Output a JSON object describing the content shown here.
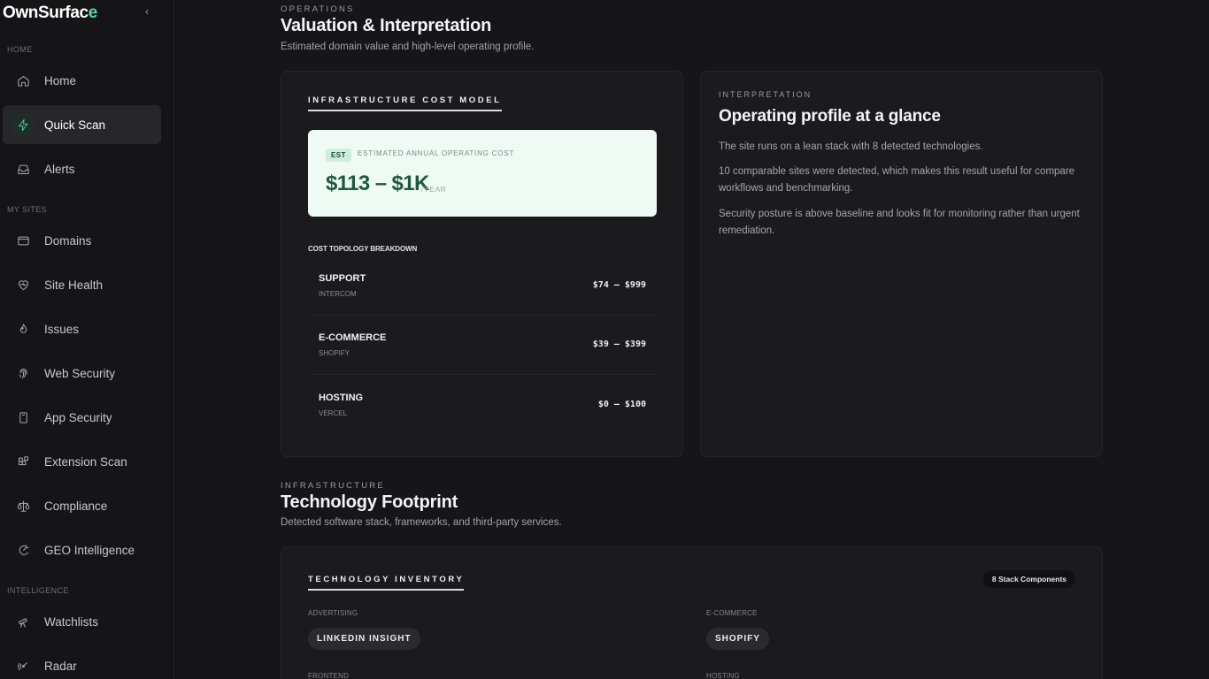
{
  "sidebar": {
    "logo_main": "OwnSurfac",
    "logo_accent": "e",
    "collapse_glyph": "‹",
    "sections": [
      {
        "label": "HOME"
      },
      {
        "label": "MY SITES"
      },
      {
        "label": "INTELLIGENCE"
      }
    ],
    "items": [
      {
        "label": "Home",
        "icon": "home-icon"
      },
      {
        "label": "Quick Scan",
        "icon": "bolt-icon",
        "active": true
      },
      {
        "label": "Alerts",
        "icon": "inbox-icon"
      },
      {
        "label": "Domains",
        "icon": "browser-icon"
      },
      {
        "label": "Site Health",
        "icon": "heart-pulse-icon"
      },
      {
        "label": "Issues",
        "icon": "flame-icon"
      },
      {
        "label": "Web Security",
        "icon": "fingerprint-icon"
      },
      {
        "label": "App Security",
        "icon": "device-icon"
      },
      {
        "label": "Extension Scan",
        "icon": "blocks-icon"
      },
      {
        "label": "Compliance",
        "icon": "scale-icon"
      },
      {
        "label": "GEO Intelligence",
        "icon": "geo-icon"
      },
      {
        "label": "Watchlists",
        "icon": "telescope-icon"
      },
      {
        "label": "Radar",
        "icon": "radar-icon"
      }
    ]
  },
  "valuation": {
    "eyebrow": "OPERATIONS",
    "title": "Valuation & Interpretation",
    "subtitle": "Estimated domain value and high-level operating profile."
  },
  "cost_model": {
    "title": "INFRASTRUCTURE COST MODEL",
    "badge": "EST",
    "label": "ESTIMATED ANNUAL OPERATING COST",
    "value": "$113 – $1K",
    "unit": "/YEAR",
    "breakdown_title": "COST TOPOLOGY BREAKDOWN",
    "rows": [
      {
        "name": "SUPPORT",
        "vendor": "INTERCOM",
        "range": "$74 — $999"
      },
      {
        "name": "E-COMMERCE",
        "vendor": "SHOPIFY",
        "range": "$39 — $399"
      },
      {
        "name": "HOSTING",
        "vendor": "VERCEL",
        "range": "$0 — $100"
      }
    ]
  },
  "interpretation": {
    "eyebrow": "INTERPRETATION",
    "title": "Operating profile at a glance",
    "paragraphs": [
      "The site runs on a lean stack with 8 detected technologies.",
      "10 comparable sites were detected, which makes this result useful for compare workflows and benchmarking.",
      "Security posture is above baseline and looks fit for monitoring rather than urgent remediation."
    ]
  },
  "footprint": {
    "eyebrow": "INFRASTRUCTURE",
    "title": "Technology Footprint",
    "subtitle": "Detected software stack, frameworks, and third-party services."
  },
  "inventory": {
    "title": "TECHNOLOGY INVENTORY",
    "badge": "8 Stack Components",
    "categories": [
      {
        "label": "ADVERTISING",
        "items": [
          "LINKEDIN INSIGHT"
        ]
      },
      {
        "label": "E-COMMERCE",
        "items": [
          "SHOPIFY"
        ]
      },
      {
        "label": "FRONTEND",
        "items": []
      },
      {
        "label": "HOSTING",
        "items": []
      }
    ]
  },
  "colors": {
    "accent": "#57d6a0",
    "estimate_bg": "#eefaf3",
    "estimate_text": "#1e5a3e"
  }
}
